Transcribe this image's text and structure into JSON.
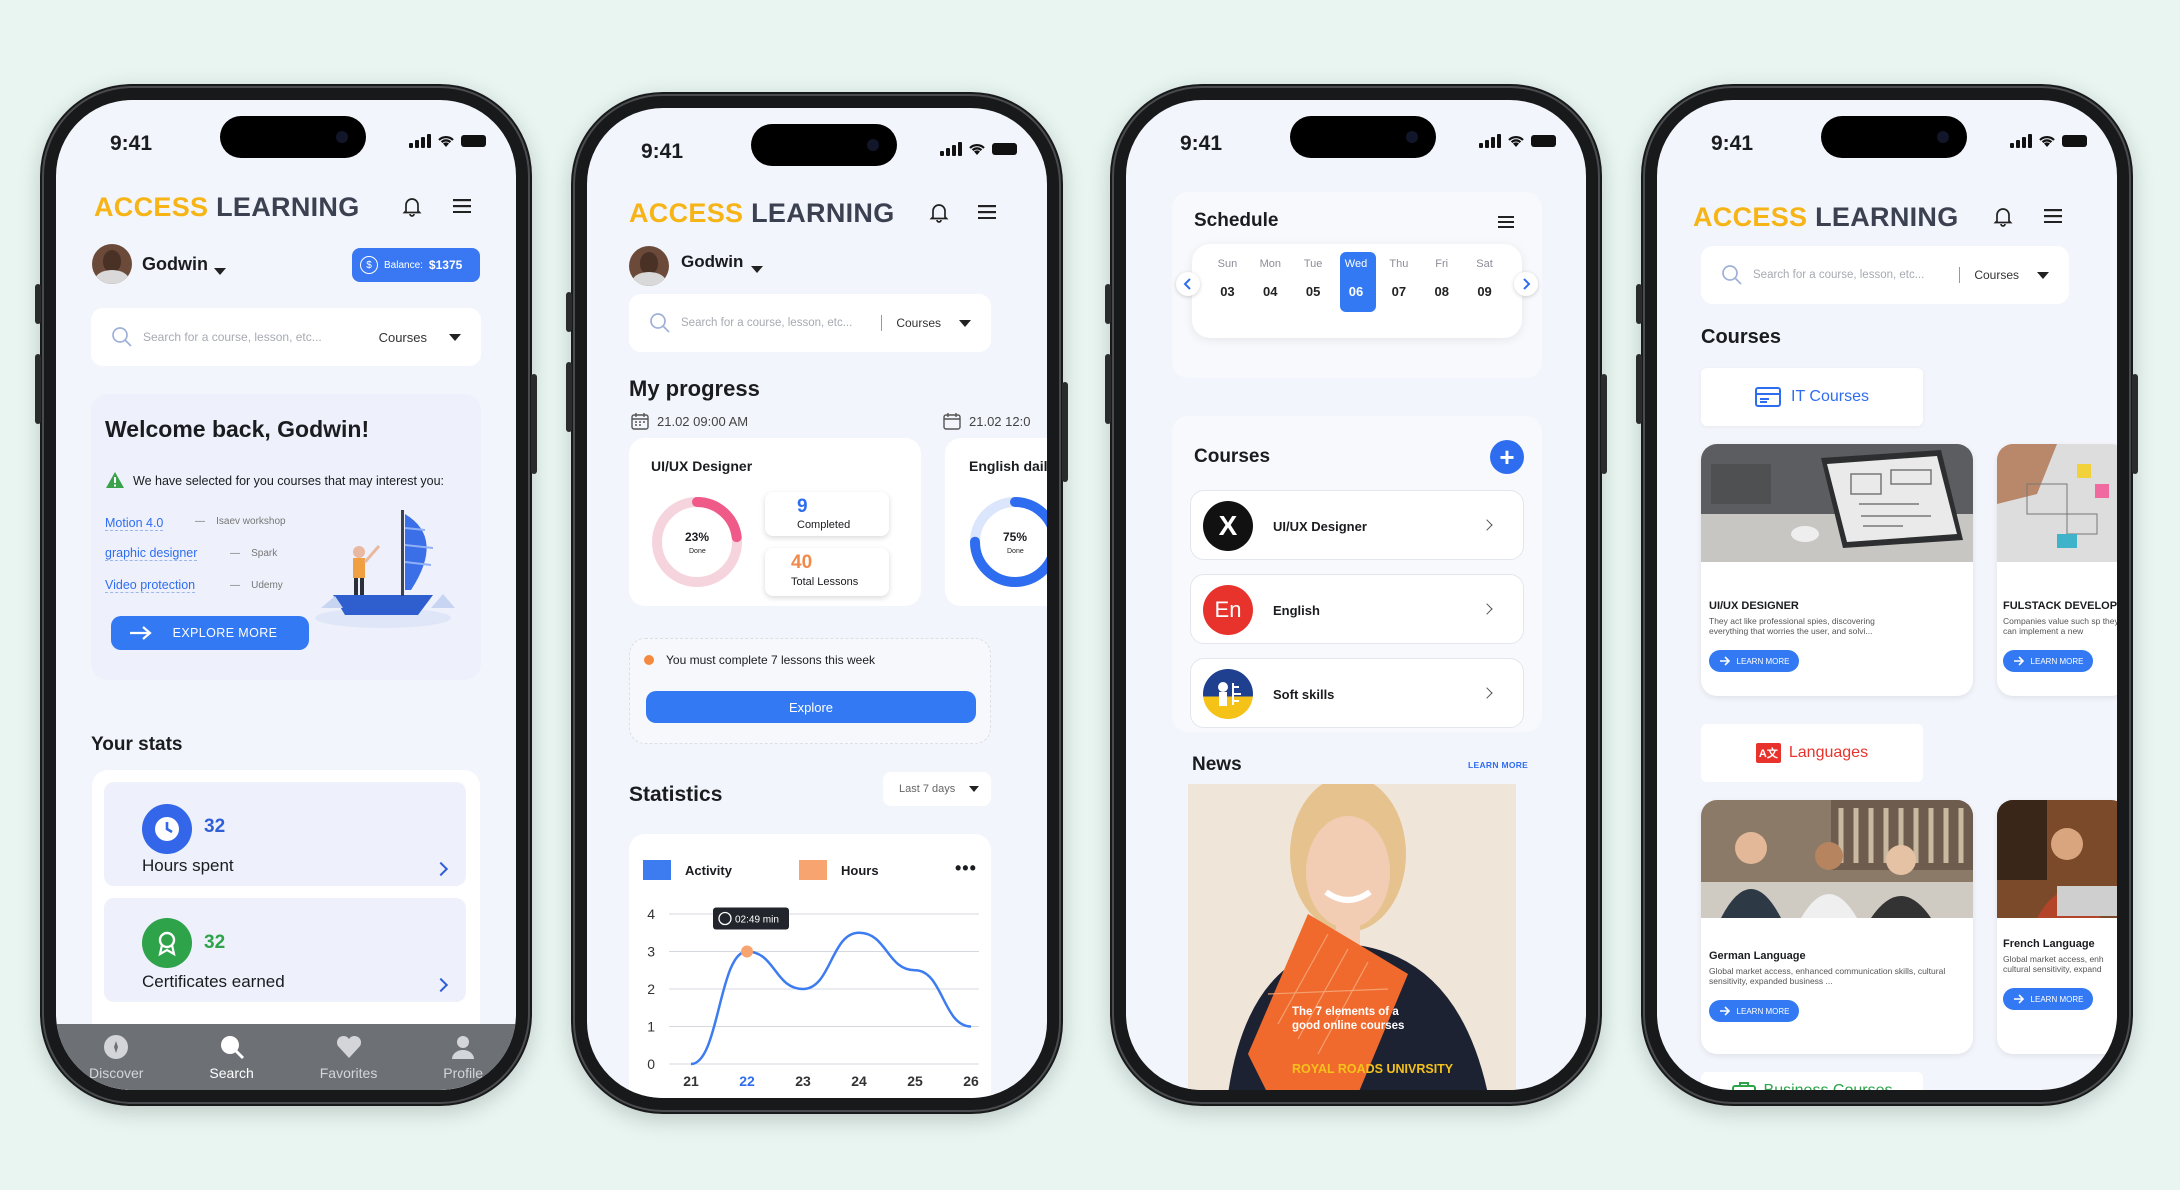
{
  "status_time": "9:41",
  "brand": {
    "part1": "ACCESS",
    "part2": " LEARNING"
  },
  "user_name": "Godwin",
  "balance": {
    "label": "Balance:",
    "value": "$1375"
  },
  "search": {
    "placeholder": "Search for a course, lesson, etc...",
    "category": "Courses"
  },
  "screen1": {
    "welcome_title": "Welcome back, Godwin!",
    "notice": "We have selected for you courses that may interest you:",
    "recommendations": [
      {
        "course": "Motion 4.0",
        "provider": "Isaev workshop"
      },
      {
        "course": "graphic designer",
        "provider": "Spark"
      },
      {
        "course": "Video protection",
        "provider": "Udemy"
      }
    ],
    "explore_label": "EXPLORE  MORE",
    "stats_title": "Your stats",
    "stats": [
      {
        "value": "32",
        "label": "Hours spent"
      },
      {
        "value": "32",
        "label": "Certificates earned"
      }
    ],
    "nav": [
      {
        "label": "Discover",
        "icon": "compass-icon"
      },
      {
        "label": "Search",
        "icon": "search-icon"
      },
      {
        "label": "Favorites",
        "icon": "heart-icon"
      },
      {
        "label": "Profile",
        "icon": "profile-icon"
      }
    ]
  },
  "screen2": {
    "progress_title": "My progress",
    "dates": [
      "21.02  09:00 AM",
      "21.02  12:0"
    ],
    "course1": {
      "title": "UI/UX Designer",
      "percent": "23%",
      "done": "Done",
      "completed_value": "9",
      "completed_label": "Completed",
      "total_value": "40",
      "total_label": "Total Lessons",
      "progress": 0.23
    },
    "course2": {
      "title": "English dail",
      "percent": "75%",
      "done": "Done",
      "progress": 0.75
    },
    "reminder": "You must complete 7 lessons this  week",
    "explore_label": "Explore",
    "statistics_title": "Statistics",
    "range_select": "Last 7 days"
  },
  "chart_data": {
    "type": "line",
    "legend": [
      "Activity",
      "Hours"
    ],
    "x": [
      "21",
      "22",
      "23",
      "24",
      "25",
      "26"
    ],
    "y_ticks": [
      "0",
      "1",
      "2",
      "3",
      "4"
    ],
    "ylim": [
      0,
      4
    ],
    "series": [
      {
        "name": "Activity",
        "values": [
          0,
          3.0,
          2.0,
          3.5,
          2.5,
          1.0
        ]
      }
    ],
    "tooltip": "02:49 min",
    "highlight_x": "22",
    "colors": {
      "activity": "#3d7bf0",
      "hours": "#f7a470"
    }
  },
  "screen3": {
    "schedule_title": "Schedule",
    "days": [
      {
        "name": "Sun",
        "num": "03"
      },
      {
        "name": "Mon",
        "num": "04"
      },
      {
        "name": "Tue",
        "num": "05"
      },
      {
        "name": "Wed",
        "num": "06"
      },
      {
        "name": "Thu",
        "num": "07"
      },
      {
        "name": "Fri",
        "num": "08"
      },
      {
        "name": "Sat",
        "num": "09"
      }
    ],
    "selected_day": "Wed",
    "courses_title": "Courses",
    "courses": [
      {
        "name": "UI/UX Designer",
        "badge": "X"
      },
      {
        "name": "English",
        "badge": "En"
      },
      {
        "name": "Soft skills",
        "badge": ""
      }
    ],
    "news_title": "News",
    "learn_more": "LEARN MORE",
    "news_caption": "The 7 elements of a good online courses",
    "news_source": "ROYAL ROADS UNIVRSITY"
  },
  "screen4": {
    "courses_title": "Courses",
    "it_category": "IT Courses",
    "lang_category": "Languages",
    "lang_badge": "A文",
    "business_category": "Business Courses",
    "it_cards": [
      {
        "title": "UI/UX DESIGNER",
        "desc": "They act like professional spies, discovering everything that worries the user, and solvi...",
        "cta": "LEARN MORE"
      },
      {
        "title": "FULSTACK DEVELOP",
        "desc": "Companies value such sp they can implement a new",
        "cta": "LEARN MORE"
      }
    ],
    "lang_cards": [
      {
        "title": "German Language",
        "desc": "Global market access, enhanced communication skills, cultural sensitivity, expanded business ...",
        "cta": "LEARN MORE"
      },
      {
        "title": "French Language",
        "desc": "Global market access, enh cultural sensitivity, expand",
        "cta": "LEARN MORE"
      }
    ]
  }
}
